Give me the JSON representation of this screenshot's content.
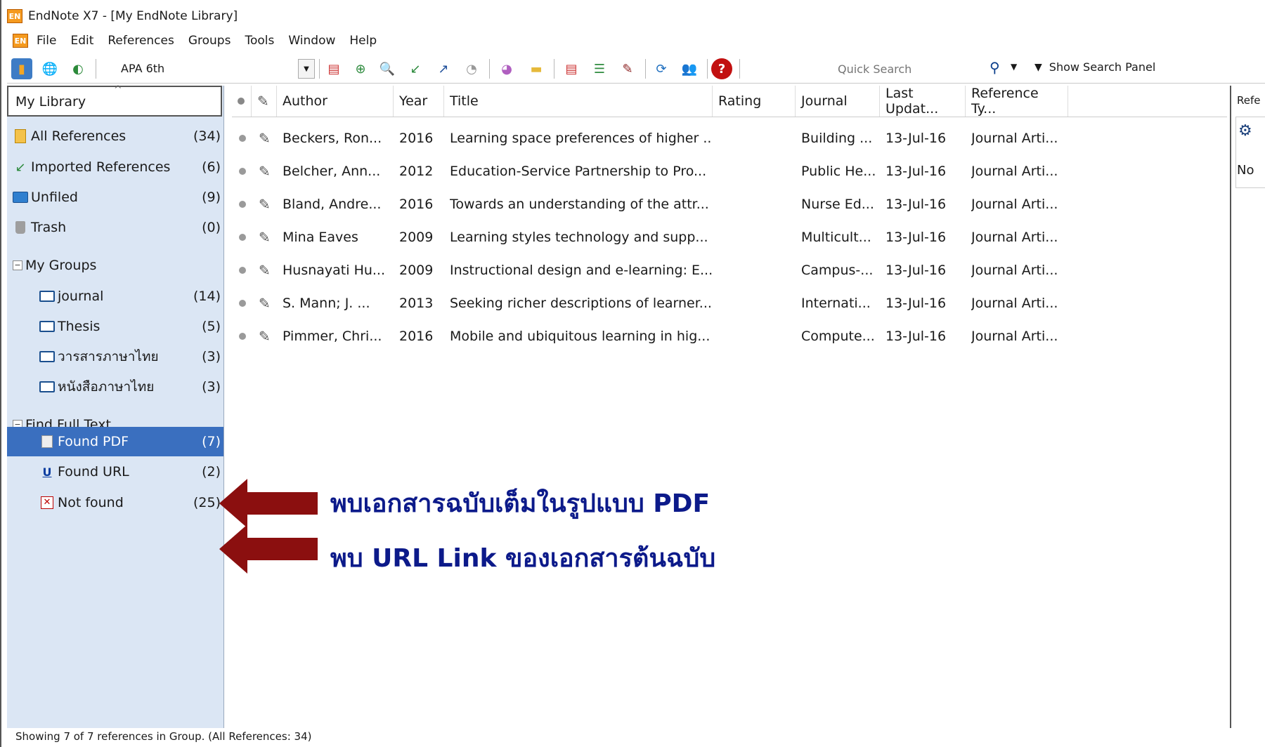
{
  "window": {
    "title": "EndNote X7 - [My EndNote Library]",
    "logo": "EN"
  },
  "menu": [
    "File",
    "Edit",
    "References",
    "Groups",
    "Tools",
    "Window",
    "Help"
  ],
  "toolbar": {
    "style": "APA 6th",
    "quick_search_placeholder": "Quick Search",
    "show_search_panel": "Show Search Panel"
  },
  "sidebar": {
    "header": "My Library",
    "items": [
      {
        "label": "All References",
        "count": "(34)"
      },
      {
        "label": "Imported References",
        "count": "(6)"
      },
      {
        "label": "Unfiled",
        "count": "(9)"
      },
      {
        "label": "Trash",
        "count": "(0)"
      }
    ],
    "my_groups": {
      "label": "My Groups",
      "items": [
        {
          "label": "journal",
          "count": "(14)"
        },
        {
          "label": "Thesis",
          "count": "(5)"
        },
        {
          "label": "วารสารภาษาไทย",
          "count": "(3)"
        },
        {
          "label": "หนังสือภาษาไทย",
          "count": "(3)"
        }
      ]
    },
    "find_full_text": {
      "label": "Find Full Text",
      "items": [
        {
          "label": "Found PDF",
          "count": "(7)"
        },
        {
          "label": "Found URL",
          "count": "(2)"
        },
        {
          "label": "Not found",
          "count": "(25)"
        }
      ]
    }
  },
  "table": {
    "columns": [
      "Author",
      "Year",
      "Title",
      "Rating",
      "Journal",
      "Last Updat...",
      "Reference Ty..."
    ],
    "rows": [
      {
        "author": "Beckers, Ron...",
        "year": "2016",
        "title": "Learning space preferences of higher ...",
        "rating": "",
        "journal": "Building ...",
        "updated": "13-Jul-16",
        "type": "Journal Arti..."
      },
      {
        "author": "Belcher, Ann...",
        "year": "2012",
        "title": "Education-Service Partnership to Pro...",
        "rating": "",
        "journal": "Public He...",
        "updated": "13-Jul-16",
        "type": "Journal Arti..."
      },
      {
        "author": "Bland, Andre...",
        "year": "2016",
        "title": "Towards an understanding of the attr...",
        "rating": "",
        "journal": "Nurse Ed...",
        "updated": "13-Jul-16",
        "type": "Journal Arti..."
      },
      {
        "author": "Mina Eaves",
        "year": "2009",
        "title": "Learning styles technology and supp...",
        "rating": "",
        "journal": "Multicult...",
        "updated": "13-Jul-16",
        "type": "Journal Arti..."
      },
      {
        "author": "Husnayati Hu...",
        "year": "2009",
        "title": "Instructional design and e-learning: E...",
        "rating": "",
        "journal": "Campus-...",
        "updated": "13-Jul-16",
        "type": "Journal Arti..."
      },
      {
        "author": "S. Mann; J. ...",
        "year": "2013",
        "title": "Seeking richer descriptions of learner...",
        "rating": "",
        "journal": "Internati...",
        "updated": "13-Jul-16",
        "type": "Journal Arti..."
      },
      {
        "author": "Pimmer, Chri...",
        "year": "2016",
        "title": "Mobile and ubiquitous learning in hig...",
        "rating": "",
        "journal": "Compute...",
        "updated": "13-Jul-16",
        "type": "Journal Arti..."
      }
    ]
  },
  "right_panel": {
    "label": "Refe",
    "text": "No"
  },
  "status": "Showing 7 of 7 references in Group. (All References: 34)",
  "annotations": {
    "pdf": "พบเอกสารฉบับเต็มในรูปแบบ PDF",
    "url": "พบ URL Link ของเอกสารต้นฉบับ"
  },
  "colors": {
    "selected": "#3a6fbf",
    "sidebar_bg": "#dbe6f4",
    "arrow": "#8b0f0f",
    "annotation_text": "#0c1a8a"
  }
}
